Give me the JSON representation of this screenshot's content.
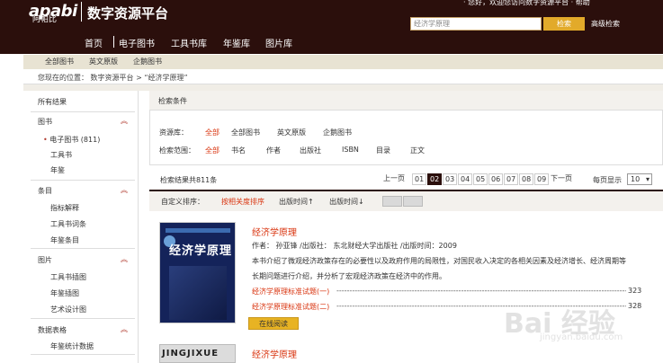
{
  "header": {
    "logo": "apabi",
    "logo_sub": "阿帕比",
    "site_title": "数字资源平台",
    "top_links": "·  您好，欢迎您访问数字资源平台  ·  帮助",
    "search_value": "经济学原理",
    "search_button": "检索",
    "advanced_search": "高级检索",
    "nav": [
      "首页",
      "电子图书",
      "工具书库",
      "年鉴库",
      "图片库"
    ]
  },
  "subnav": [
    "全部图书",
    "英文原版",
    "企鹅图书"
  ],
  "breadcrumb": "您现在的位置：  数字资源平台  >  “经济学原理”",
  "sidebar": {
    "all_results": "所有结果",
    "sections": [
      {
        "title": "图书",
        "items": [
          "电子图书  (811)",
          "工具书",
          "年鉴"
        ]
      },
      {
        "title": "条目",
        "items": [
          "指标解释",
          "工具书词条",
          "年鉴条目"
        ]
      },
      {
        "title": "图片",
        "items": [
          "工具书插图",
          "年鉴插图",
          "艺术设计图"
        ]
      },
      {
        "title": "数据表格",
        "items": [
          "年鉴统计数据"
        ]
      }
    ]
  },
  "conditions": {
    "title": "检索条件",
    "resource_label": "资源库：",
    "resource_options": [
      "全部",
      "全部图书",
      "英文原版",
      "企鹅图书"
    ],
    "scope_label": "检索范围：",
    "scope_options": [
      "全部",
      "书名",
      "作者",
      "出版社",
      "ISBN",
      "目录",
      "正文"
    ]
  },
  "results": {
    "count": "检索结果共811条",
    "pager": [
      "上一页",
      "01",
      "02",
      "03",
      "04",
      "05",
      "06",
      "07",
      "08",
      "09",
      "下一页"
    ],
    "per_page_label": "每页显示",
    "per_page_value": "10",
    "sort_label": "自定义排序：",
    "sort_options": [
      "按相关度排序",
      "出版时间↑",
      "出版时间↓"
    ]
  },
  "books": [
    {
      "title": "经济学原理",
      "cover_text": "经济学原理",
      "author_line": "作者：  孙亚锋    /出版社：  东北财经大学出版社  /出版时间：2009",
      "desc1": "本书介绍了微观经济政策存在的必要性以及政府作用的局限性，对国民收入决定的各相关因素及经济增长、经济周期等",
      "desc2": "长期问题进行介绍，并分析了宏观经济政策在经济中的作用。",
      "chapters": [
        {
          "title": "经济学原理标准试题(一)",
          "page": "323"
        },
        {
          "title": "经济学原理标准试题(二)",
          "page": "328"
        }
      ],
      "read_button": "在线阅读"
    },
    {
      "title": "经济学原理",
      "cover_text": "JINGJIXUE"
    }
  ],
  "watermark": {
    "main": "Bai 经验",
    "sub": "jingyan.baidu.com"
  }
}
